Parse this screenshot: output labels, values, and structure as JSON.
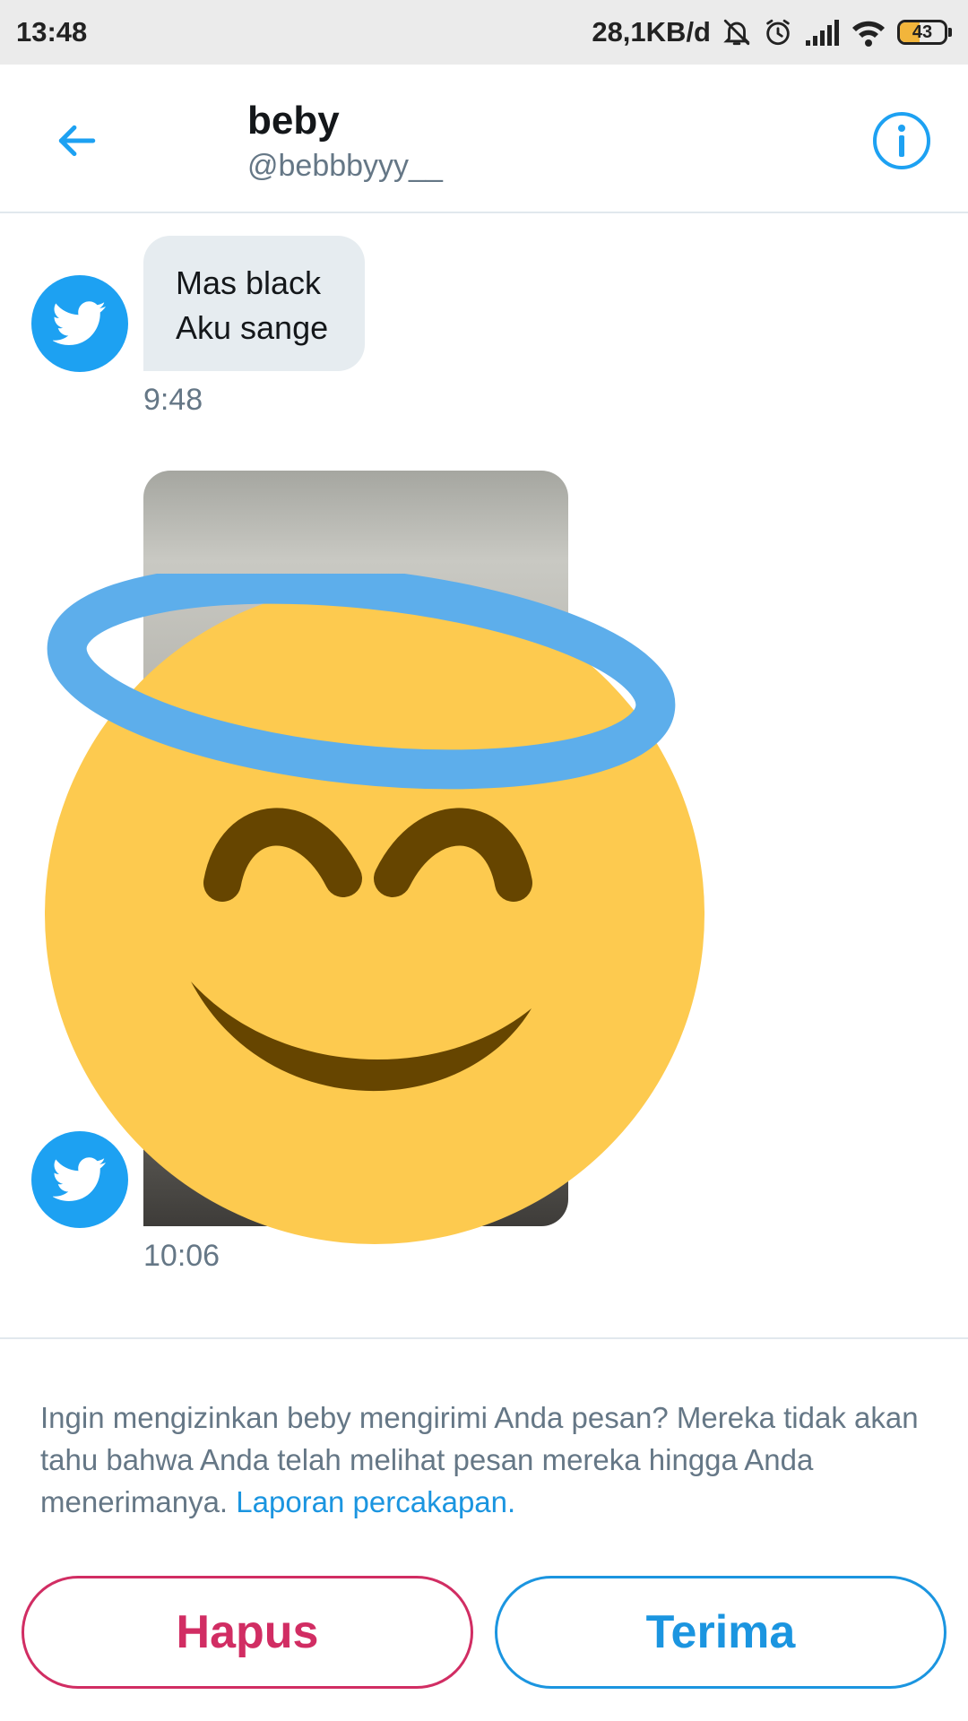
{
  "status_bar": {
    "time": "13:48",
    "network_speed": "28,1KB/d",
    "battery_level": "43",
    "battery_percent": 43,
    "icons": [
      "bell-muted-icon",
      "alarm-icon",
      "signal-icon",
      "wifi-icon",
      "battery-icon"
    ]
  },
  "header": {
    "title": "beby",
    "handle": "@bebbbyyy__",
    "back_icon": "arrow-left-icon",
    "info_icon": "info-icon"
  },
  "messages": [
    {
      "type": "text",
      "lines": [
        "Mas black",
        "Aku sange"
      ],
      "time": "9:48"
    },
    {
      "type": "media",
      "time": "10:06"
    }
  ],
  "request": {
    "text": "Ingin mengizinkan beby mengirimi Anda pesan? Mereka tidak akan tahu bahwa Anda telah melihat pesan mereka hingga Anda menerimanya.",
    "report_link": "Laporan percakapan."
  },
  "actions": {
    "delete_label": "Hapus",
    "accept_label": "Terima"
  },
  "colors": {
    "accent": "#1da1f2",
    "link": "#1b95e0",
    "danger": "#d12d63",
    "bubble": "#e6ecf0",
    "emoji_face": "#fdca4f",
    "emoji_halo": "#5daeeb",
    "emoji_features": "#664500"
  }
}
